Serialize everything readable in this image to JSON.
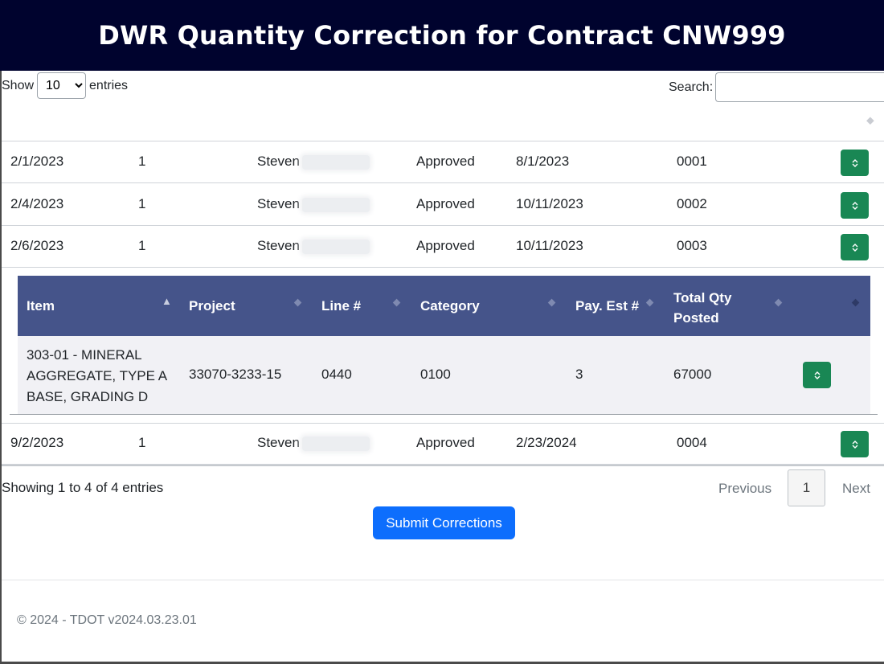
{
  "header": {
    "title_prefix": "DWR Quantity Correction for Contract",
    "contract": "CNW999"
  },
  "length": {
    "show": "Show",
    "selected": "10",
    "entries": "entries"
  },
  "search": {
    "label": "Search:",
    "placeholder": ""
  },
  "rows": [
    {
      "date": "2/1/2023",
      "rev": "1",
      "name": "Steven",
      "status": "Approved",
      "approved": "8/1/2023",
      "num": "0001"
    },
    {
      "date": "2/4/2023",
      "rev": "1",
      "name": "Steven",
      "status": "Approved",
      "approved": "10/11/2023",
      "num": "0002"
    },
    {
      "date": "2/6/2023",
      "rev": "1",
      "name": "Steven",
      "status": "Approved",
      "approved": "10/11/2023",
      "num": "0003"
    },
    {
      "date": "9/2/2023",
      "rev": "1",
      "name": "Steven",
      "status": "Approved",
      "approved": "2/23/2024",
      "num": "0004"
    }
  ],
  "child": {
    "headers": {
      "item": "Item",
      "project": "Project",
      "line": "Line #",
      "category": "Category",
      "payest": "Pay. Est #",
      "totalqty": "Total Qty Posted"
    },
    "row": {
      "item": "303-01 - MINERAL AGGREGATE, TYPE A BASE, GRADING D",
      "project": "33070-3233-15",
      "line": "0440",
      "category": "0100",
      "payest": "3",
      "totalqty": "67000"
    }
  },
  "info": "Showing 1 to 4 of 4 entries",
  "pager": {
    "previous": "Previous",
    "page": "1",
    "next": "Next"
  },
  "submit_label": "Submit Corrections",
  "footer": "© 2024 - TDOT v2024.03.23.01",
  "icons": {
    "expand": "chevron-up-down-icon",
    "sort": "sort-icon"
  },
  "colors": {
    "header_bg": "#00032e",
    "child_head_bg": "#45548a",
    "expand_btn": "#198754",
    "submit_btn": "#0d6efd"
  }
}
